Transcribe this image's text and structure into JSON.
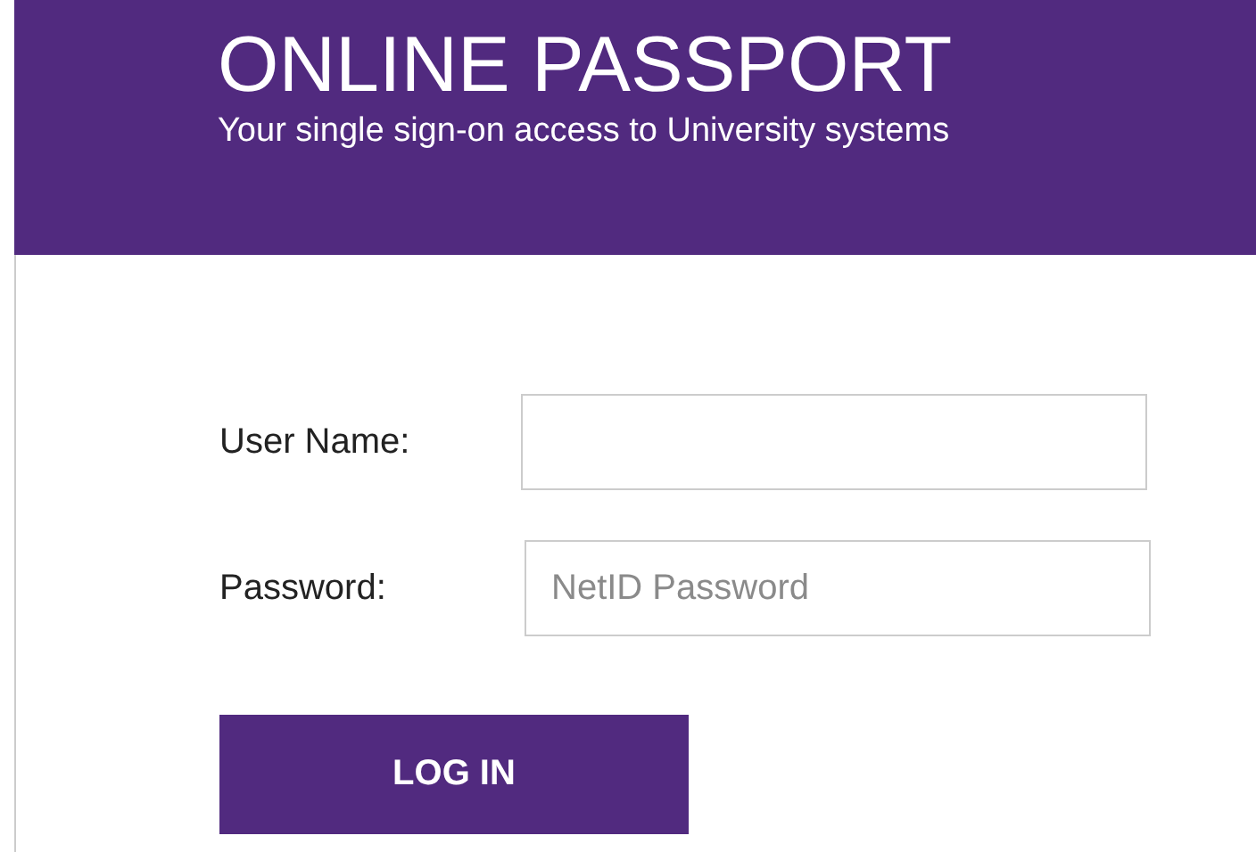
{
  "header": {
    "title": "ONLINE PASSPORT",
    "subtitle": "Your single sign-on access to University systems"
  },
  "form": {
    "fields": [
      {
        "label": "User Name:"
      },
      {
        "label": "Password:",
        "placeholder": "NetID Password"
      }
    ],
    "button": "LOG IN"
  }
}
